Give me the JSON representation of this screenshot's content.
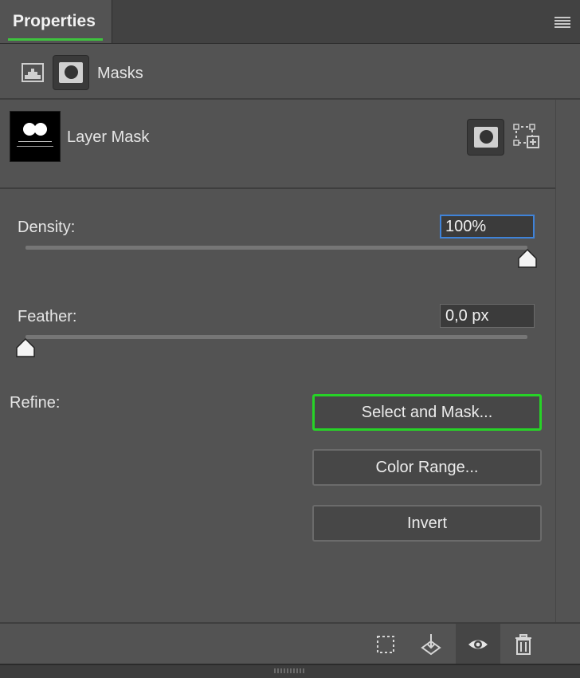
{
  "panel": {
    "tab_label": "Properties",
    "menu_icon": "panel-menu-icon"
  },
  "mode": {
    "masks_label": "Masks",
    "pixel_icon": "pixel-layer-icon",
    "mask_icon": "layer-mask-icon"
  },
  "layer": {
    "title": "Layer Mask",
    "apply_icon": "add-pixel-mask-icon",
    "vector_icon": "add-vector-mask-icon"
  },
  "density": {
    "label": "Density:",
    "value": "100%",
    "percent": 100
  },
  "feather": {
    "label": "Feather:",
    "value": "0,0 px",
    "percent": 0
  },
  "refine": {
    "label": "Refine:",
    "select_and_mask": "Select and Mask...",
    "color_range": "Color Range...",
    "invert": "Invert"
  },
  "footer": {
    "icons": [
      "load-selection-icon",
      "apply-mask-icon",
      "visibility-eye-icon",
      "delete-trash-icon"
    ]
  },
  "colors": {
    "accent_green": "#27d327",
    "focus_blue": "#3f83d9",
    "panel_bg": "#535353"
  }
}
